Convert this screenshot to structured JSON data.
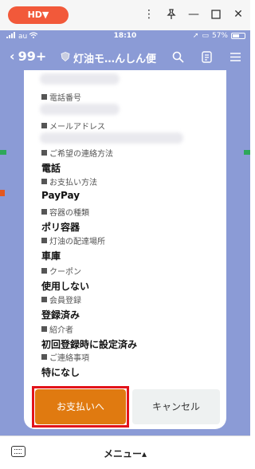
{
  "window": {
    "hd_label": "HD▼"
  },
  "status_bar": {
    "carrier": "au",
    "time": "18:10",
    "battery": "57%",
    "battery_level": 0.57
  },
  "header": {
    "back_count": "99+",
    "title": "灯油モ…んしん便"
  },
  "form": {
    "fields": [
      {
        "label": "電話番号",
        "value": ""
      },
      {
        "label": "メールアドレス",
        "value": ""
      },
      {
        "label": "ご希望の連絡方法",
        "value": "電話"
      },
      {
        "label": "お支払い方法",
        "value": "PayPay"
      },
      {
        "label": "容器の種類",
        "value": "ポリ容器"
      },
      {
        "label": "灯油の配達場所",
        "value": "車庫"
      },
      {
        "label": "クーポン",
        "value": "使用しない"
      },
      {
        "label": "会員登録",
        "value": "登録済み"
      },
      {
        "label": "紹介者",
        "value": "初回登録時に設定済み"
      },
      {
        "label": "ご連絡事項",
        "value": "特になし"
      }
    ]
  },
  "buttons": {
    "pay": "お支払いへ",
    "cancel": "キャンセル"
  },
  "bottom_bar": {
    "menu_label": "メニュー▴"
  },
  "colors": {
    "pay_button": "#e07a10",
    "highlight": "#e2141a",
    "background": "#8b9bd6"
  }
}
